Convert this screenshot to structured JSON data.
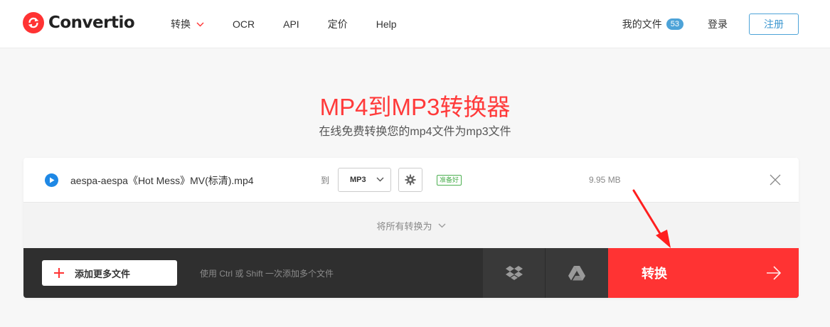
{
  "header": {
    "brand": "Convertio",
    "nav": [
      {
        "label": "转换",
        "has_dropdown": true
      },
      {
        "label": "OCR",
        "has_dropdown": false
      },
      {
        "label": "API",
        "has_dropdown": false
      },
      {
        "label": "定价",
        "has_dropdown": false
      },
      {
        "label": "Help",
        "has_dropdown": false
      }
    ],
    "my_files_label": "我的文件",
    "my_files_count": "53",
    "login_label": "登录",
    "signup_label": "注册"
  },
  "hero": {
    "title": "MP4到MP3转换器",
    "subtitle": "在线免费转换您的mp4文件为mp3文件"
  },
  "file": {
    "name": "aespa-aespa《Hot Mess》MV(标清).mp4",
    "to_label": "到",
    "format": "MP3",
    "status": "准备好",
    "size": "9.95 MB"
  },
  "convert_all_label": "将所有转换为",
  "bottom": {
    "add_files_label": "添加更多文件",
    "hint": "使用 Ctrl 或 Shift 一次添加多个文件",
    "convert_label": "转换"
  },
  "colors": {
    "accent": "#ff3333",
    "link_blue": "#4da3d8",
    "ready_green": "#4caf50",
    "dark_bar": "#2f2f2f"
  },
  "icons": [
    "convertio-logo-icon",
    "chevron-down-icon",
    "play-icon",
    "gear-icon",
    "close-icon",
    "plus-icon",
    "dropbox-icon",
    "google-drive-icon",
    "arrow-right-icon"
  ]
}
